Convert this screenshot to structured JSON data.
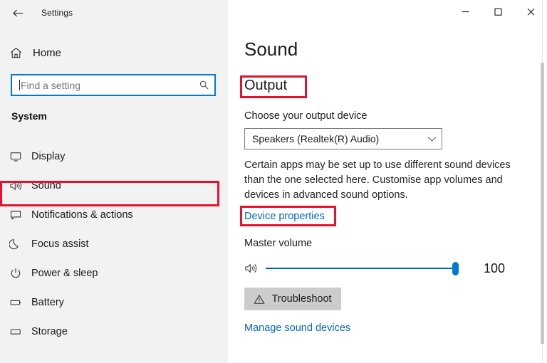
{
  "window": {
    "title": "Settings",
    "back_icon": "back-arrow-icon",
    "controls": [
      {
        "name": "minimize-button",
        "glyph": "—"
      },
      {
        "name": "maximize-button",
        "glyph": "□"
      },
      {
        "name": "close-button",
        "glyph": "✕"
      }
    ]
  },
  "sidebar": {
    "home": {
      "label": "Home",
      "icon": "home-icon"
    },
    "search": {
      "value": "",
      "placeholder": "Find a setting",
      "icon": "search-icon"
    },
    "section": "System",
    "items": [
      {
        "label": "Display",
        "icon": "monitor-icon",
        "selected": false
      },
      {
        "label": "Sound",
        "icon": "speaker-icon",
        "selected": true
      },
      {
        "label": "Notifications & actions",
        "icon": "speech-bubble-icon",
        "selected": false
      },
      {
        "label": "Focus assist",
        "icon": "moon-icon",
        "selected": false
      },
      {
        "label": "Power & sleep",
        "icon": "power-icon",
        "selected": false
      },
      {
        "label": "Battery",
        "icon": "battery-icon",
        "selected": false
      },
      {
        "label": "Storage",
        "icon": "disk-icon",
        "selected": false
      }
    ]
  },
  "main": {
    "page_title": "Sound",
    "output": {
      "group_title": "Output",
      "device_label": "Choose your output device",
      "device_value": "Speakers (Realtek(R) Audio)",
      "description": "Certain apps may be set up to use different sound devices than the one selected here. Customise app volumes and devices in advanced sound options.",
      "device_properties_link": "Device properties"
    },
    "volume": {
      "label": "Master volume",
      "value": "100",
      "percent": 100,
      "icon": "speaker-icon"
    },
    "troubleshoot_button": "Troubleshoot",
    "troubleshoot_icon": "warning-triangle-icon",
    "manage_link": "Manage sound devices"
  },
  "annotations": {
    "highlight_color": "#e8112d",
    "boxes": [
      "Output",
      "Sound",
      "Device properties"
    ]
  },
  "colors": {
    "accent": "#0078d7",
    "link": "#0067c0",
    "sidebar_bg": "#f2f2f2",
    "highlight": "#e8112d"
  }
}
